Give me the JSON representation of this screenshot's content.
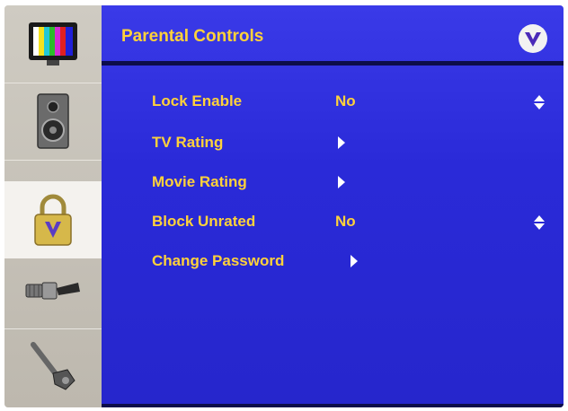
{
  "header": {
    "title": "Parental Controls"
  },
  "brand": {
    "logo": "vizio-v-logo"
  },
  "sidebar": {
    "items": [
      {
        "name": "picture",
        "icon": "tv-color-bars-icon",
        "active": false
      },
      {
        "name": "audio",
        "icon": "speaker-icon",
        "active": false
      },
      {
        "name": "parental",
        "icon": "padlock-icon",
        "active": true
      },
      {
        "name": "setup",
        "icon": "cable-connector-icon",
        "active": false
      },
      {
        "name": "advanced",
        "icon": "tool-icon",
        "active": false
      }
    ]
  },
  "menu": {
    "items": [
      {
        "label": "Lock Enable",
        "value": "No",
        "adjustable": true
      },
      {
        "label": "TV  Rating",
        "value": "",
        "submenu": true
      },
      {
        "label": "Movie Rating",
        "value": "",
        "submenu": true
      },
      {
        "label": "Block Unrated",
        "value": "No",
        "adjustable": true
      },
      {
        "label": "Change Password",
        "value": "",
        "submenu": true
      }
    ]
  },
  "colors": {
    "accent_text": "#ffd23a",
    "panel_blue": "#2a2ad8",
    "sidebar": "#cfcbc2"
  }
}
